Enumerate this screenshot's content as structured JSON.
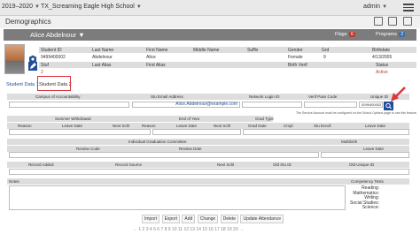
{
  "topbar": {
    "year": "2019–2020",
    "school": "TX_Screaming Eagle High School",
    "user": "admin"
  },
  "titlebar": {
    "title": "Demographics"
  },
  "student_header": {
    "name": "Alice Abdelnour",
    "flags_label": "Flags",
    "flags_count": "6",
    "programs_label": "Programs",
    "programs_count": "2"
  },
  "demographics_table": {
    "headers": [
      "Student ID",
      "Last Name",
      "First Name",
      "Middle Name",
      "Suffix",
      "Gender",
      "Grd",
      "Birthdate"
    ],
    "values": [
      "9499400002",
      "Abdelnour",
      "Alice",
      "",
      "",
      "Female",
      "9",
      "4/13/2005"
    ],
    "headers2": [
      "Stuf",
      "Last Alias",
      "First Alias",
      "Birth Verif",
      "Status"
    ],
    "values2": [
      "2",
      "",
      "",
      "",
      "Active"
    ]
  },
  "tabs": [
    "Student Data 1",
    "Student Data 2"
  ],
  "fields": {
    "campus_label": "Campus of Accountability",
    "email_label": "Stu Email Address",
    "email_value": "Alice.Abdelnour@example.com",
    "network_label": "Network Login ID",
    "pass_label": "Verif Pass Code",
    "unique_label": "Unique ID",
    "unique_value": "0099400002",
    "tooltip": "The Service Account must be configured on the School Options page to use this feature."
  },
  "withdrawal": {
    "summer_label": "Summer Withdrawal",
    "end_year_label": "End of Year",
    "grad_type_label": "Grad Type",
    "reason": "Reason",
    "leave_date": "Leave Date",
    "next_schl": "Next Schl",
    "grad_date": "Grad Date",
    "cmpl": "Cmpl",
    "stu_enroll": "Stu Enroll",
    "reason2": "Reason",
    "leave_date2": "Leave Date"
  },
  "grad_committee": {
    "label": "Individual Graduation Committee",
    "review_code": "Review Code",
    "review_date": "Review Date",
    "multibirth": "Multibirth",
    "multibirth_date": "Leave Date"
  },
  "records": {
    "record_added": "Record Added",
    "record_source": "Record Source",
    "next_schl": "Next Schl",
    "old_stu_id": "Old Stu ID",
    "old_unique_id": "Old Unique ID",
    "records_label": "Records",
    "notes_label": "Notes"
  },
  "competency": {
    "label": "Competency Tests",
    "items": [
      "Reading:",
      "Mathematics:",
      "Writing:",
      "Social Studies:",
      "Science:"
    ]
  },
  "actions": [
    "Import",
    "Export",
    "Add",
    "Change",
    "Delete",
    "Update Attendance"
  ],
  "footer": "← 1 2 3 4 5 6 7 8 9 10 11 12 13 14 15 16 17 18 19 20 →"
}
